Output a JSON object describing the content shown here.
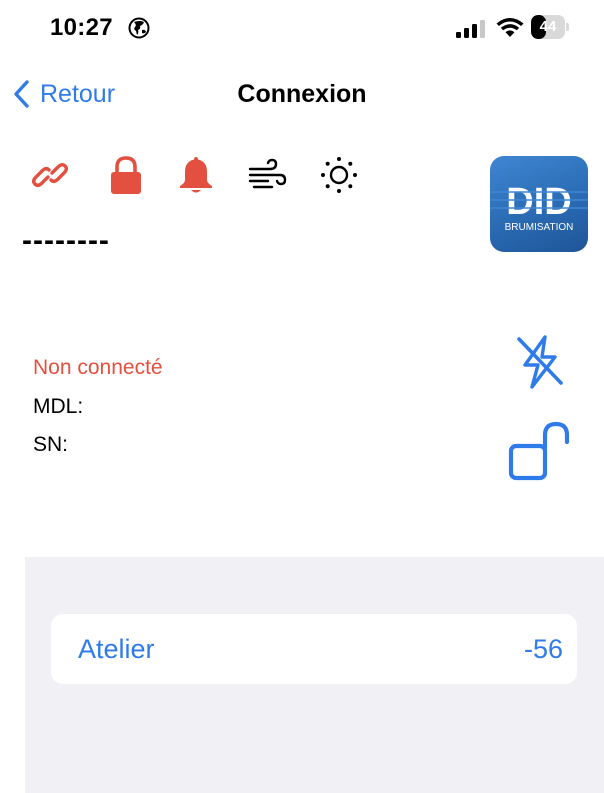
{
  "status_bar": {
    "time": "10:27",
    "battery": "44",
    "battery_level": 0.44
  },
  "nav": {
    "back_label": "Retour",
    "title": "Connexion"
  },
  "status_icons": [
    "link-icon",
    "lock-icon",
    "bell-icon",
    "wind-icon",
    "sun-icon"
  ],
  "placeholder_dashes": "--------",
  "logo": {
    "brand": "DID",
    "subtitle": "BRUMISATION"
  },
  "device": {
    "connection_status": "Non connecté",
    "mdl_label": "MDL:",
    "sn_label": "SN:"
  },
  "list": {
    "items": [
      {
        "label": "Atelier",
        "value": "-56"
      }
    ]
  },
  "colors": {
    "accent": "#2f7bea",
    "alert": "#e4503f",
    "list_background": "#f1f1f5"
  }
}
